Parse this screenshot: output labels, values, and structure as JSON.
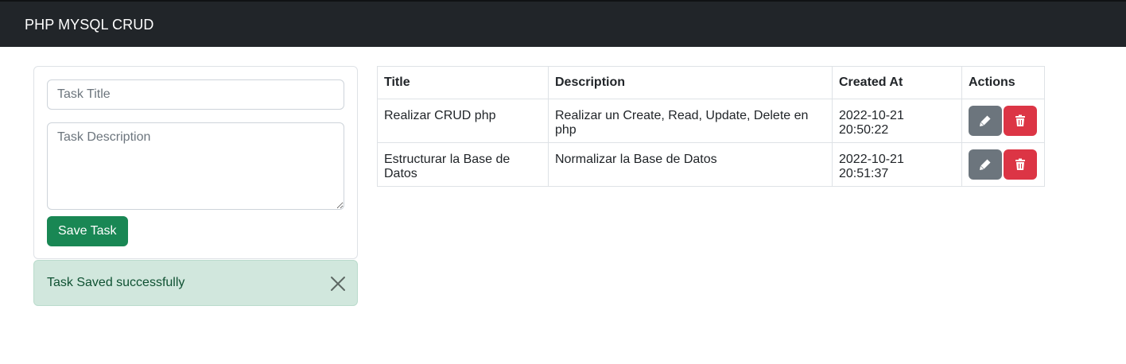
{
  "navbar": {
    "brand": "PHP MYSQL CRUD"
  },
  "form": {
    "title_placeholder": "Task Title",
    "description_placeholder": "Task Description",
    "save_label": "Save Task"
  },
  "alert": {
    "message": "Task Saved successfully",
    "close_icon": "close-icon"
  },
  "table": {
    "headers": [
      "Title",
      "Description",
      "Created At",
      "Actions"
    ],
    "rows": [
      {
        "title": "Realizar CRUD php",
        "description": "Realizar un Create, Read, Update, Delete en php",
        "created_at": "2022-10-21 20:50:22"
      },
      {
        "title": "Estructurar la Base de Datos",
        "description": "Normalizar la Base de Datos",
        "created_at": "2022-10-21 20:51:37"
      }
    ],
    "row_actions": {
      "edit_icon": "pencil-icon",
      "delete_icon": "trash-icon"
    }
  },
  "colors": {
    "navbar": "#212529",
    "success": "#198754",
    "secondary": "#6c757d",
    "danger": "#dc3545",
    "alert_bg": "#d1e7dd",
    "alert_text": "#0f5132"
  }
}
